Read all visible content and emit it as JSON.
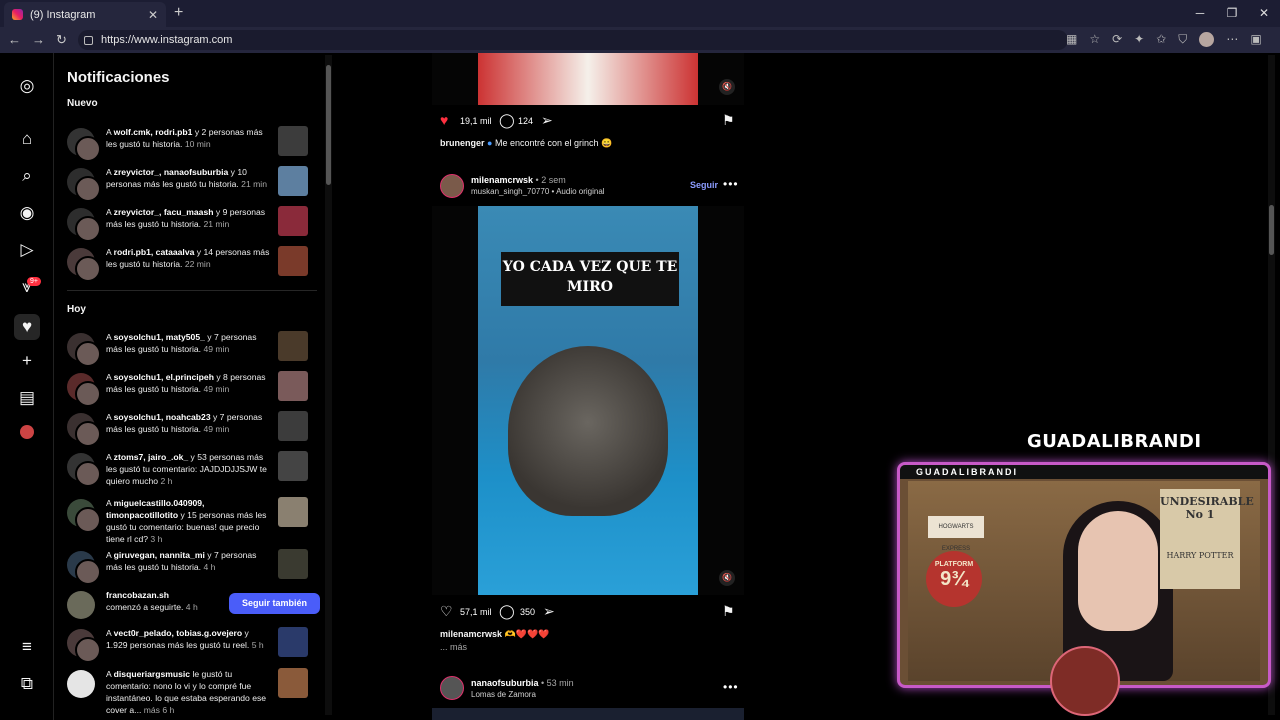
{
  "browser": {
    "tab_title": "(9) Instagram",
    "url": "https://www.instagram.com",
    "new_tab": "+",
    "close": "✕"
  },
  "panel": {
    "title": "Notificaciones",
    "section_new": "Nuevo",
    "section_today": "Hoy",
    "new_items": [
      {
        "pre": "A ",
        "users": "wolf.cmk, rodri.pb1",
        "rest": " y 2 personas más les gustó tu historia.",
        "time": " 10 min"
      },
      {
        "pre": "A ",
        "users": "zreyvictor_, nanaofsuburbia",
        "rest": " y 10 personas más les gustó tu historia.",
        "time": " 21 min"
      },
      {
        "pre": "A ",
        "users": "zreyvictor_, facu_maash",
        "rest": " y 9 personas más les gustó tu historia.",
        "time": " 21 min"
      },
      {
        "pre": "A ",
        "users": "rodri.pb1, cataaalva",
        "rest": " y 14 personas más les gustó tu historia.",
        "time": " 22 min"
      }
    ],
    "today_items": [
      {
        "pre": "A ",
        "users": "soysolchu1, maty505_",
        "rest": " y 7 personas más les gustó tu historia.",
        "time": " 49 min"
      },
      {
        "pre": "A ",
        "users": "soysolchu1, el.principeh",
        "rest": " y 8 personas más les gustó tu historia.",
        "time": " 49 min"
      },
      {
        "pre": "A ",
        "users": "soysolchu1, noahcab23",
        "rest": " y 7 personas más les gustó tu historia.",
        "time": " 49 min"
      },
      {
        "pre": "A ",
        "users": "ztoms7, jairo_.ok_",
        "rest": " y 53 personas más les gustó tu comentario: JAJDJDJJSJW te quiero mucho",
        "time": " 2 h"
      },
      {
        "pre": "A ",
        "users": "miguelcastillo.040909, timonpacotillotito",
        "rest": " y 15 personas más les gustó tu comentario: buenas! que precio tiene rl cd?",
        "time": " 3 h"
      },
      {
        "pre": "A ",
        "users": "giruvegan, nannita_mi",
        "rest": " y 7 personas más les gustó tu historia.",
        "time": " 4 h"
      },
      {
        "pre": "",
        "users": "francobazan.sh",
        "rest": " comenzó a seguirte.",
        "time": " 4 h",
        "button": "Seguir también"
      },
      {
        "pre": "A ",
        "users": "vect0r_pelado, tobias.g.ovejero",
        "rest": " y 1.929 personas más les gustó tu reel.",
        "time": " 5 h"
      },
      {
        "pre": "A ",
        "users": "disqueriargsmusic",
        "rest": " le gustó tu comentario: nono lo vi y lo compré fue instantáneo. lo que estaba esperando ese cover a...",
        "time": " más 6 h"
      }
    ]
  },
  "posts": {
    "p1": {
      "likes": "19,1 mil",
      "comments": "124",
      "caption_user": "brunenger",
      "caption_text": " Me encontré con el grinch 😀"
    },
    "p2": {
      "user": "milenamcrwsk",
      "time": " • 2 sem",
      "sub": "muskan_singh_70770 • Audio original",
      "follow": "Seguir",
      "overlay": "YO CADA VEZ QUE TE MIRO",
      "likes": "57,1 mil",
      "comments": "350",
      "caption_user": "milenamcrwsk",
      "caption_text": " 🫶❤️❤️❤️",
      "more": "... más"
    },
    "p3": {
      "user": "nanaofsuburbia",
      "time": " • 53 min",
      "sub": "Lomas de Zamora"
    }
  },
  "stream": {
    "name": "GUADALIBRANDI",
    "cam_label": "GUADALIBRANDI",
    "poster_title": "UNDESIRABLE",
    "poster_no": "No 1",
    "poster_name": "HARRY POTTER",
    "platform_text": "PLATFORM",
    "platform_num": "9¾",
    "hogwarts": "HOGWARTS EXPRESS"
  },
  "colors": {
    "accent_blue": "#4a5df9",
    "like_red": "#ff3040",
    "link_blue": "#8c9cff",
    "overlay_border": "#c85ac8"
  }
}
